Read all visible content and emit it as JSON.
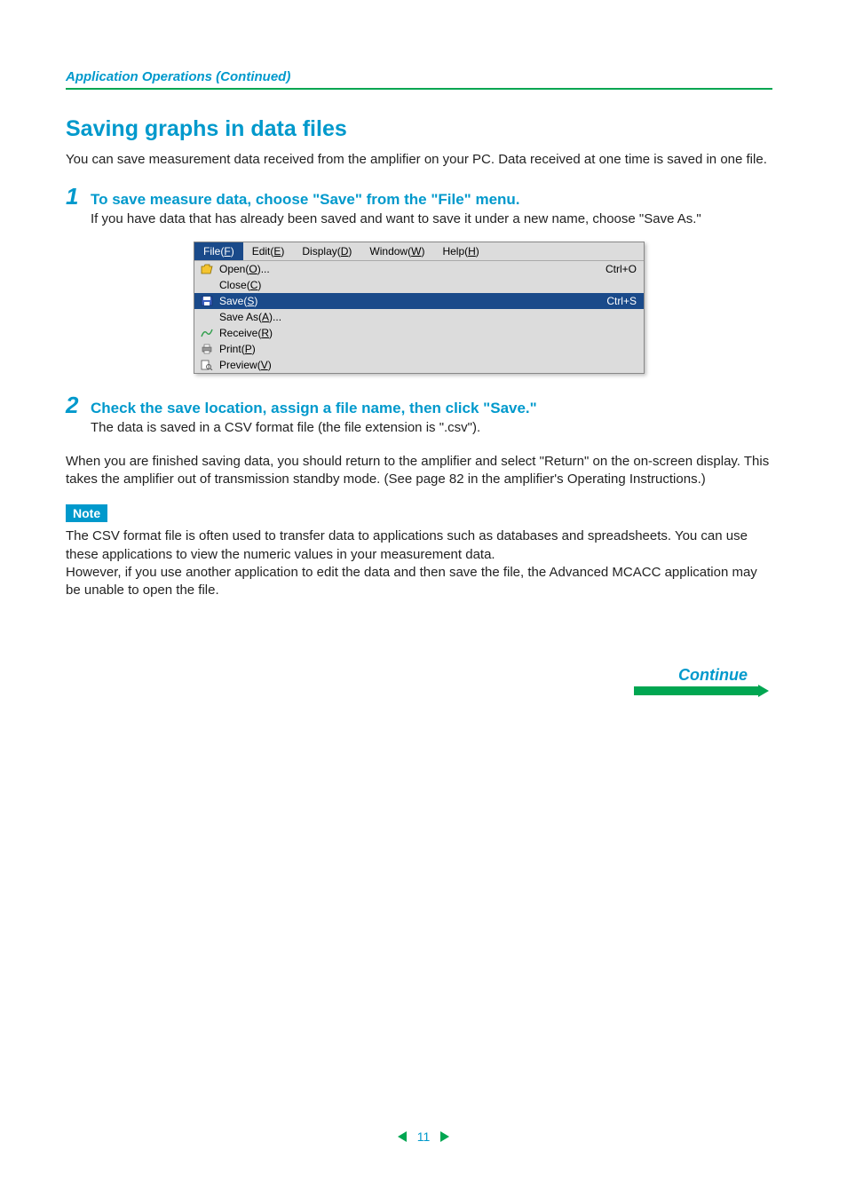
{
  "breadcrumb": "Application Operations (Continued)",
  "section_title": "Saving graphs in data files",
  "intro": "You can save measurement data received from the amplifier on your PC. Data received at one time is saved in one file.",
  "step1": {
    "num": "1",
    "title": "To save measure data, choose \"Save\" from the \"File\" menu.",
    "body": "If you have data that has already been saved and want to save it under a new name, choose \"Save As.\""
  },
  "app_window": {
    "menubar": [
      {
        "label": "File",
        "accel": "F",
        "active": true
      },
      {
        "label": "Edit",
        "accel": "E",
        "active": false
      },
      {
        "label": "Display",
        "accel": "D",
        "active": false
      },
      {
        "label": "Window",
        "accel": "W",
        "active": false
      },
      {
        "label": "Help",
        "accel": "H",
        "active": false
      }
    ],
    "dropdown": [
      {
        "icon": "open-icon",
        "label": "Open",
        "accel": "O",
        "suffix": "...",
        "shortcut": "Ctrl+O",
        "highlighted": false
      },
      {
        "icon": "",
        "label": "Close",
        "accel": "C",
        "suffix": "",
        "shortcut": "",
        "highlighted": false
      },
      {
        "icon": "save-icon",
        "label": "Save",
        "accel": "S",
        "suffix": "",
        "shortcut": "Ctrl+S",
        "highlighted": true
      },
      {
        "icon": "",
        "label": "Save As",
        "accel": "A",
        "suffix": "...",
        "shortcut": "",
        "highlighted": false
      },
      {
        "icon": "receive-icon",
        "label": "Receive",
        "accel": "R",
        "suffix": "",
        "shortcut": "",
        "highlighted": false
      },
      {
        "icon": "print-icon",
        "label": "Print",
        "accel": "P",
        "suffix": "",
        "shortcut": "",
        "highlighted": false
      },
      {
        "icon": "preview-icon",
        "label": "Preview",
        "accel": "V",
        "suffix": "",
        "shortcut": "",
        "highlighted": false
      }
    ]
  },
  "step2": {
    "num": "2",
    "title": "Check the save location, assign a file name, then click \"Save.\"",
    "body": "The data is saved in a CSV format file (the file extension is \".csv\")."
  },
  "after_steps": "When you are finished saving data, you should return to the amplifier and select \"Return\" on the on-screen display. This takes the amplifier out of transmission standby mode. (See page 82 in the amplifier's Operating Instructions.)",
  "note": {
    "badge": "Note",
    "text1": "The CSV format file is often used to transfer data to applications such as databases and spreadsheets. You can use these applications to view the numeric values in your measurement data.",
    "text2": "However, if you use another application to edit the data and then save the file, the Advanced MCACC application may be unable to open the file."
  },
  "continue_label": "Continue",
  "page_number": "11"
}
